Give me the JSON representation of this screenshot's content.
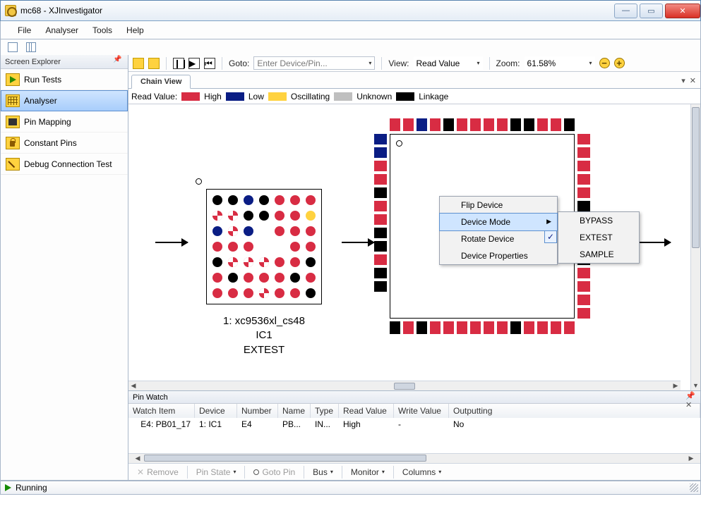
{
  "window": {
    "title": "mc68 - XJInvestigator"
  },
  "menu": [
    "File",
    "Analyser",
    "Tools",
    "Help"
  ],
  "sidebar": {
    "title": "Screen Explorer",
    "items": [
      {
        "label": "Run Tests"
      },
      {
        "label": "Analyser"
      },
      {
        "label": "Pin Mapping"
      },
      {
        "label": "Constant Pins"
      },
      {
        "label": "Debug Connection Test"
      }
    ]
  },
  "toolbar": {
    "goto_label": "Goto:",
    "goto_placeholder": "Enter Device/Pin...",
    "view_label": "View:",
    "view_value": "Read Value",
    "zoom_label": "Zoom:",
    "zoom_value": "61.58%"
  },
  "tab": {
    "label": "Chain View"
  },
  "legend": {
    "title": "Read Value:",
    "items": [
      "High",
      "Low",
      "Oscillating",
      "Unknown",
      "Linkage"
    ]
  },
  "device1": {
    "line1": "1: xc9536xl_cs48",
    "line2": "IC1",
    "line3": "EXTEST"
  },
  "context": {
    "items": [
      "Flip Device",
      "Device Mode",
      "Rotate Device",
      "Device Properties"
    ],
    "sub": [
      "BYPASS",
      "EXTEST",
      "SAMPLE"
    ]
  },
  "pinwatch": {
    "title": "Pin Watch",
    "cols": [
      "Watch Item",
      "Device",
      "Number",
      "Name",
      "Type",
      "Read Value",
      "Write Value",
      "Outputting"
    ],
    "row": {
      "watch": "E4: PB01_17",
      "device": "1: IC1",
      "number": "E4",
      "name": "PB...",
      "type": "IN...",
      "read": "High",
      "write": "-",
      "out": "No"
    },
    "footer": {
      "remove": "Remove",
      "pinstate": "Pin State",
      "goto": "Goto Pin",
      "bus": "Bus",
      "monitor": "Monitor",
      "columns": "Columns"
    }
  },
  "status": {
    "text": "Running"
  }
}
